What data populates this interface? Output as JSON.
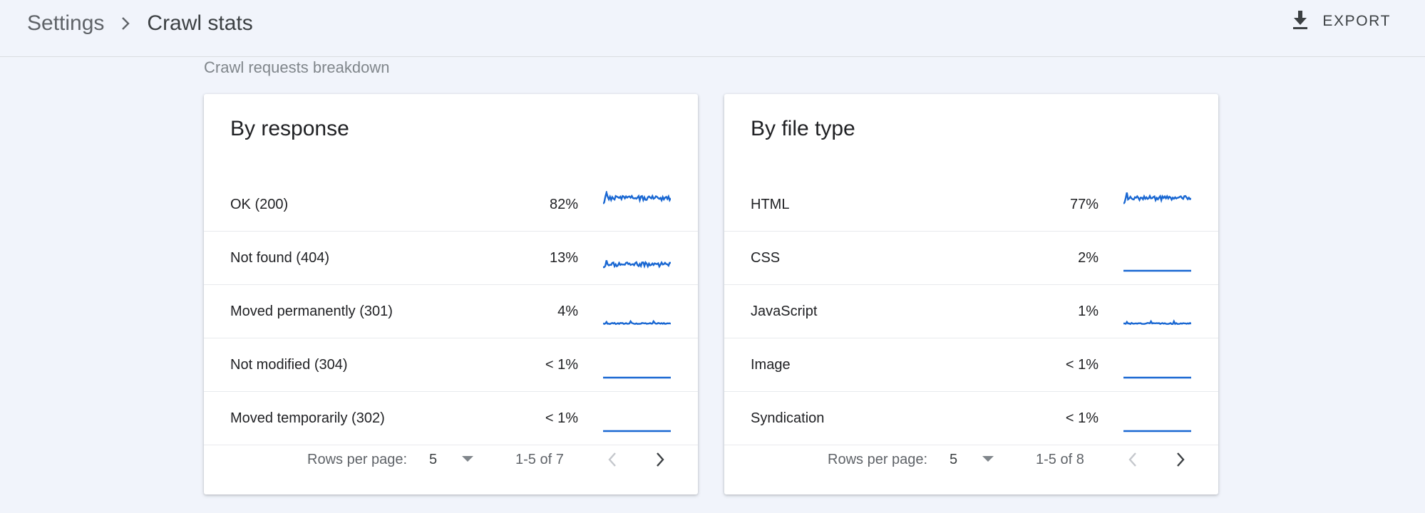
{
  "header": {
    "breadcrumb_parent": "Settings",
    "breadcrumb_current": "Crawl stats",
    "export_label": "EXPORT"
  },
  "section_title": "Crawl requests breakdown",
  "colors": {
    "accent": "#1a73e8",
    "sparkline": "#1967d2",
    "background": "#f1f4fb"
  },
  "cards": [
    {
      "title": "By response",
      "rows": [
        {
          "label": "OK (200)",
          "value": "82%",
          "trend": "high"
        },
        {
          "label": "Not found (404)",
          "value": "13%",
          "trend": "medium"
        },
        {
          "label": "Moved permanently (301)",
          "value": "4%",
          "trend": "low"
        },
        {
          "label": "Not modified (304)",
          "value": "< 1%",
          "trend": "flat"
        },
        {
          "label": "Moved temporarily (302)",
          "value": "< 1%",
          "trend": "flat"
        }
      ],
      "pager": {
        "rows_per_page_label": "Rows per page:",
        "rows_per_page": "5",
        "range": "1-5 of 7"
      }
    },
    {
      "title": "By file type",
      "rows": [
        {
          "label": "HTML",
          "value": "77%",
          "trend": "high"
        },
        {
          "label": "CSS",
          "value": "2%",
          "trend": "flat"
        },
        {
          "label": "JavaScript",
          "value": "1%",
          "trend": "low"
        },
        {
          "label": "Image",
          "value": "< 1%",
          "trend": "flat"
        },
        {
          "label": "Syndication",
          "value": "< 1%",
          "trend": "flat"
        }
      ],
      "pager": {
        "rows_per_page_label": "Rows per page:",
        "rows_per_page": "5",
        "range": "1-5 of 8"
      }
    }
  ],
  "icons": {
    "chevron": "chevron-right-icon",
    "export": "download-icon",
    "dropdown": "arrow-drop-down-icon",
    "prev": "chevron-left-icon",
    "next": "chevron-right-icon"
  }
}
